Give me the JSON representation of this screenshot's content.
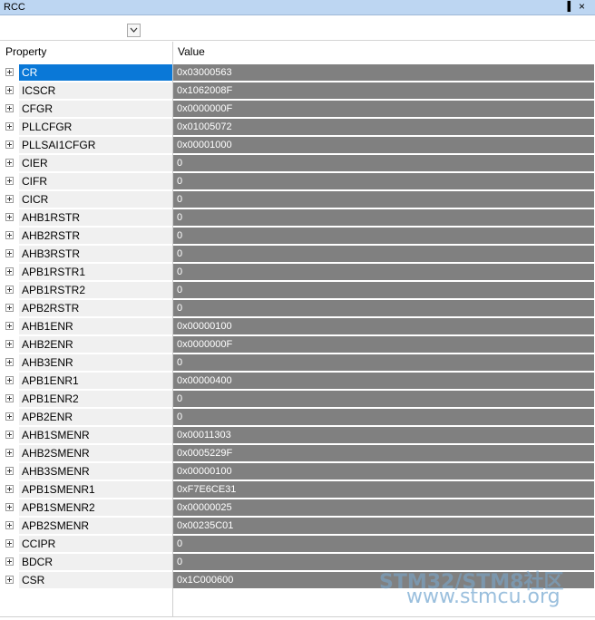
{
  "window": {
    "title": "RCC",
    "pin_glyph": "▐",
    "close_glyph": "×"
  },
  "toolbar": {
    "dropdown_icon": "chevron-down-icon"
  },
  "grid": {
    "columns": {
      "property": "Property",
      "value": "Value"
    },
    "selected_index": 0,
    "rows": [
      {
        "name": "CR",
        "value": "0x03000563"
      },
      {
        "name": "ICSCR",
        "value": "0x1062008F"
      },
      {
        "name": "CFGR",
        "value": "0x0000000F"
      },
      {
        "name": "PLLCFGR",
        "value": "0x01005072"
      },
      {
        "name": "PLLSAI1CFGR",
        "value": "0x00001000"
      },
      {
        "name": "CIER",
        "value": "0"
      },
      {
        "name": "CIFR",
        "value": "0"
      },
      {
        "name": "CICR",
        "value": "0"
      },
      {
        "name": "AHB1RSTR",
        "value": "0"
      },
      {
        "name": "AHB2RSTR",
        "value": "0"
      },
      {
        "name": "AHB3RSTR",
        "value": "0"
      },
      {
        "name": "APB1RSTR1",
        "value": "0"
      },
      {
        "name": "APB1RSTR2",
        "value": "0"
      },
      {
        "name": "APB2RSTR",
        "value": "0"
      },
      {
        "name": "AHB1ENR",
        "value": "0x00000100"
      },
      {
        "name": "AHB2ENR",
        "value": "0x0000000F"
      },
      {
        "name": "AHB3ENR",
        "value": "0"
      },
      {
        "name": "APB1ENR1",
        "value": "0x00000400"
      },
      {
        "name": "APB1ENR2",
        "value": "0"
      },
      {
        "name": "APB2ENR",
        "value": "0"
      },
      {
        "name": "AHB1SMENR",
        "value": "0x00011303"
      },
      {
        "name": "AHB2SMENR",
        "value": "0x0005229F"
      },
      {
        "name": "AHB3SMENR",
        "value": "0x00000100"
      },
      {
        "name": "APB1SMENR1",
        "value": "0xF7E6CE31"
      },
      {
        "name": "APB1SMENR2",
        "value": "0x00000025"
      },
      {
        "name": "APB2SMENR",
        "value": "0x00235C01"
      },
      {
        "name": "CCIPR",
        "value": "0"
      },
      {
        "name": "BDCR",
        "value": "0"
      },
      {
        "name": "CSR",
        "value": "0x1C000600"
      }
    ]
  },
  "watermark": {
    "line1": "STM32/STM8社区",
    "line2": "www.stmcu.org"
  },
  "colors": {
    "selected": "#0a78d7",
    "value_bg": "#808080",
    "titlebar": "#bdd6f2"
  }
}
